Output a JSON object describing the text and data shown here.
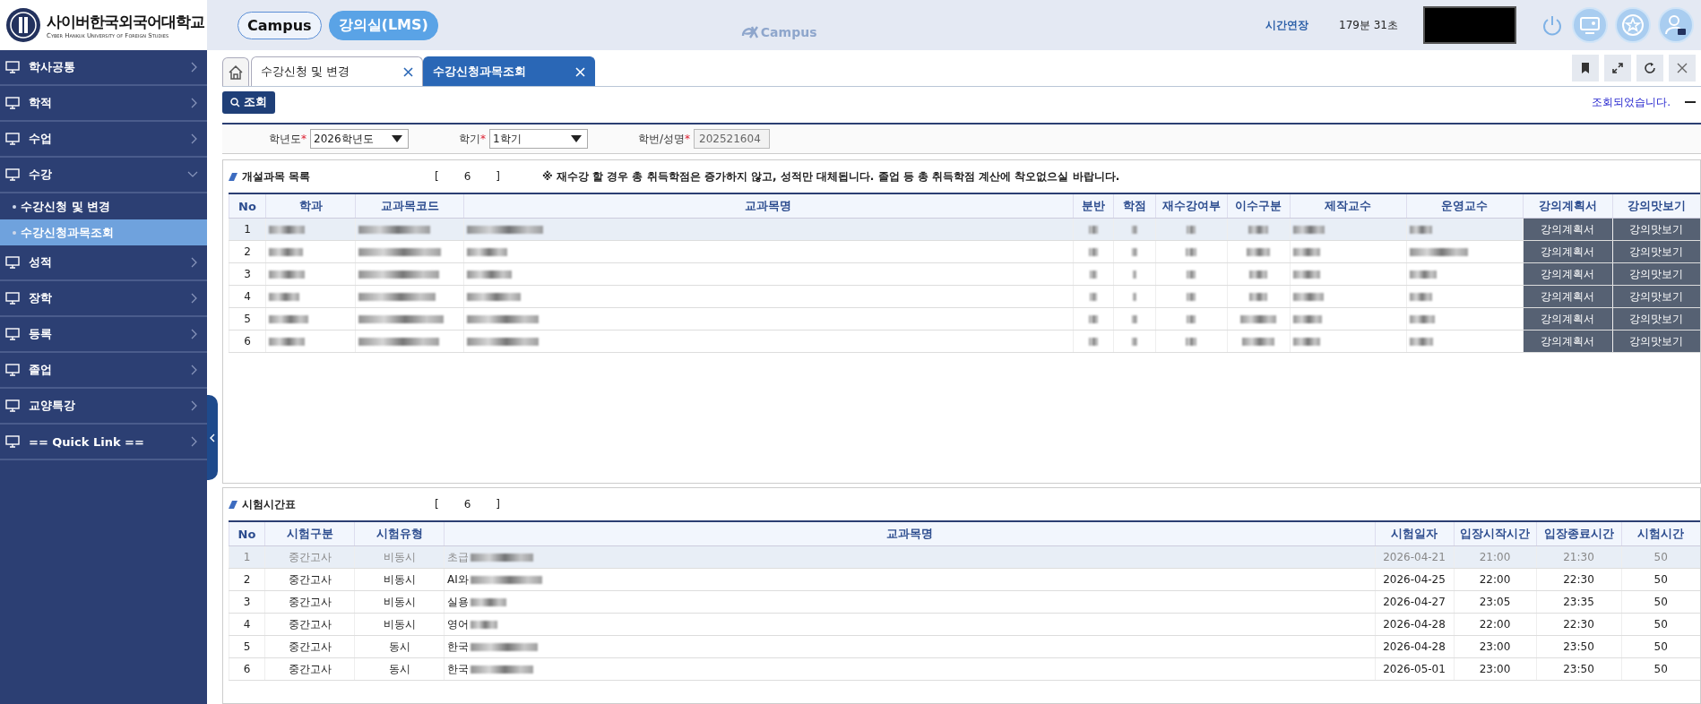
{
  "header": {
    "logo_title": "사이버한국외국어대학교",
    "logo_subtitle": "Cyber Hankuk University of Foreign Studies",
    "nav": [
      {
        "label": "Campus",
        "selected": false
      },
      {
        "label": "강의실(LMS)",
        "selected": true
      }
    ],
    "brand": "Campus",
    "extend_link": "시간연장",
    "timer": "179분 31초"
  },
  "sidebar": {
    "items": [
      {
        "label": "학사공통",
        "expanded": false
      },
      {
        "label": "학적",
        "expanded": false
      },
      {
        "label": "수업",
        "expanded": false
      },
      {
        "label": "수강",
        "expanded": true,
        "children": [
          {
            "label": "수강신청 및 변경",
            "selected": false
          },
          {
            "label": "수강신청과목조회",
            "selected": true
          }
        ]
      },
      {
        "label": "성적",
        "expanded": false
      },
      {
        "label": "장학",
        "expanded": false
      },
      {
        "label": "등록",
        "expanded": false
      },
      {
        "label": "졸업",
        "expanded": false
      },
      {
        "label": "교양특강",
        "expanded": false
      },
      {
        "label": "== Quick Link ==",
        "expanded": false
      }
    ]
  },
  "tabs": [
    {
      "label": "수강신청 및 변경",
      "selected": false
    },
    {
      "label": "수강신청과목조회",
      "selected": true
    }
  ],
  "search_button": "조회",
  "message": "조회되었습니다.",
  "filters": [
    {
      "label": "학년도",
      "required_mark": "*",
      "kind": "select",
      "value": "2026학년도"
    },
    {
      "label": "학기",
      "required_mark": "*",
      "kind": "select",
      "value": "1학기"
    },
    {
      "label": "학번/성명",
      "required_mark": "*",
      "kind": "readonly",
      "value": "202521604"
    }
  ],
  "course_list": {
    "title": "개설과목 목록",
    "count": {
      "open": "[",
      "value": "6",
      "close": "]"
    },
    "notice": "※ 재수강 할 경우 총 취득학점은 증가하지 않고, 성적만 대체됩니다. 졸업 등 총 취득학점 계산에 착오없으실 바랍니다.",
    "columns": [
      {
        "label": "No",
        "kind": "no"
      },
      {
        "label": "학과",
        "kind": "redacted"
      },
      {
        "label": "교과목코드",
        "kind": "redacted"
      },
      {
        "label": "교과목명",
        "kind": "redacted"
      },
      {
        "label": "분반",
        "kind": "redacted"
      },
      {
        "label": "학점",
        "kind": "redacted"
      },
      {
        "label": "재수강여부",
        "kind": "redacted"
      },
      {
        "label": "이수구분",
        "kind": "redacted"
      },
      {
        "label": "제작교수",
        "kind": "redacted"
      },
      {
        "label": "운영교수",
        "kind": "redacted"
      },
      {
        "label": "강의계획서",
        "kind": "plan"
      },
      {
        "label": "강의맛보기",
        "kind": "preview"
      }
    ],
    "rows": [
      {
        "no": "1",
        "selected": true,
        "plan": "강의계획서",
        "preview": "강의맛보기"
      },
      {
        "no": "2",
        "selected": false,
        "plan": "강의계획서",
        "preview": "강의맛보기"
      },
      {
        "no": "3",
        "selected": false,
        "plan": "강의계획서",
        "preview": "강의맛보기"
      },
      {
        "no": "4",
        "selected": false,
        "plan": "강의계획서",
        "preview": "강의맛보기"
      },
      {
        "no": "5",
        "selected": false,
        "plan": "강의계획서",
        "preview": "강의맛보기"
      },
      {
        "no": "6",
        "selected": false,
        "plan": "강의계획서",
        "preview": "강의맛보기"
      }
    ]
  },
  "exam_table": {
    "title": "시험시간표",
    "count": {
      "open": "[",
      "value": "6",
      "close": "]"
    },
    "columns": [
      "No",
      "시험구분",
      "시험유형",
      "교과목명",
      "시험일자",
      "입장시작시간",
      "입장종료시간",
      "시험시간"
    ],
    "rows": [
      {
        "no": "1",
        "type": "중간고사",
        "mode": "비동시",
        "subject": "초급",
        "date": "2026-04-21",
        "start": "21:00",
        "end": "21:30",
        "duration": "50",
        "selected": true
      },
      {
        "no": "2",
        "type": "중간고사",
        "mode": "비동시",
        "subject": "AI와",
        "date": "2026-04-25",
        "start": "22:00",
        "end": "22:30",
        "duration": "50",
        "selected": false
      },
      {
        "no": "3",
        "type": "중간고사",
        "mode": "비동시",
        "subject": "실용",
        "date": "2026-04-27",
        "start": "23:05",
        "end": "23:35",
        "duration": "50",
        "selected": false
      },
      {
        "no": "4",
        "type": "중간고사",
        "mode": "비동시",
        "subject": "영어",
        "date": "2026-04-28",
        "start": "22:00",
        "end": "22:30",
        "duration": "50",
        "selected": false
      },
      {
        "no": "5",
        "type": "중간고사",
        "mode": "동시",
        "subject": "한국",
        "date": "2026-04-28",
        "start": "23:00",
        "end": "23:50",
        "duration": "50",
        "selected": false
      },
      {
        "no": "6",
        "type": "중간고사",
        "mode": "동시",
        "subject": "한국",
        "date": "2026-05-01",
        "start": "23:00",
        "end": "23:50",
        "duration": "50",
        "selected": false
      }
    ]
  }
}
